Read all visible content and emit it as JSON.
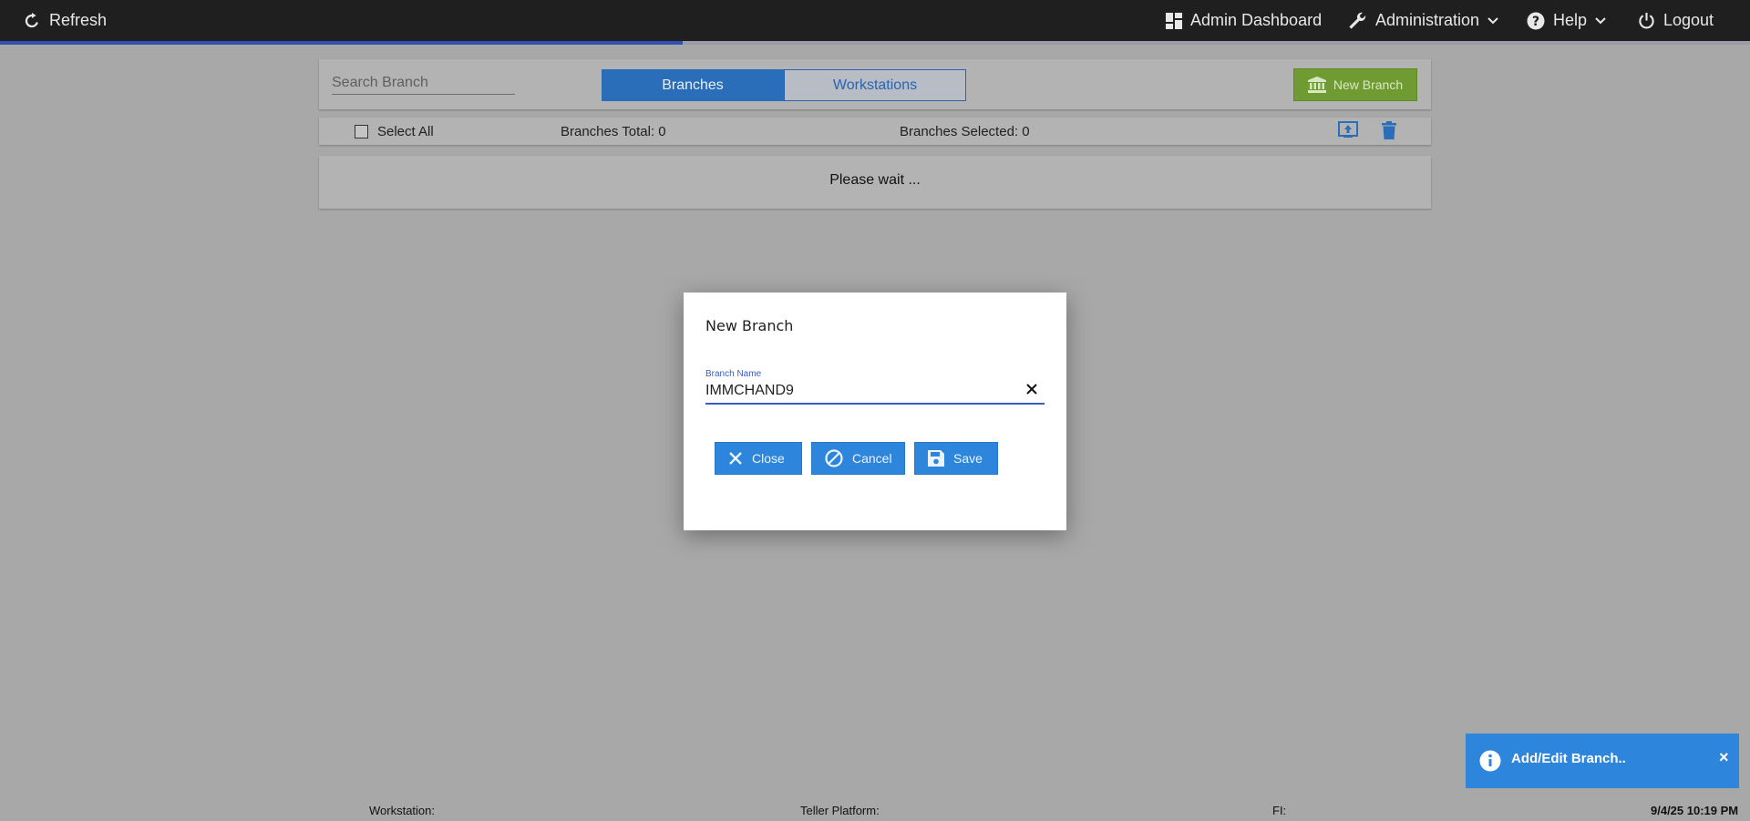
{
  "topbar": {
    "refresh_label": "Refresh",
    "admin_dashboard_label": "Admin Dashboard",
    "administration_label": "Administration",
    "help_label": "Help",
    "logout_label": "Logout"
  },
  "progress": {
    "fraction": 0.39
  },
  "toolbar": {
    "search_placeholder": "Search Branch",
    "tabs": [
      {
        "label": "Branches",
        "active": true
      },
      {
        "label": "Workstations",
        "active": false
      }
    ],
    "new_branch_label": "New Branch"
  },
  "selection": {
    "select_all_label": "Select All",
    "branches_total": "Branches Total: 0",
    "branches_selected": "Branches Selected: 0"
  },
  "list": {
    "status_message": "Please wait ..."
  },
  "modal": {
    "title": "New Branch",
    "field_label": "Branch Name",
    "field_value": "IMMCHAND9",
    "buttons": {
      "close": "Close",
      "cancel": "Cancel",
      "save": "Save"
    }
  },
  "toast": {
    "message": "Add/Edit Branch..",
    "close_glyph": "×"
  },
  "footer": {
    "workstation": "Workstation:",
    "teller_platform": "Teller Platform:",
    "fi": "FI:",
    "datetime": "9/4/25 10:19 PM"
  },
  "colors": {
    "topbar": "#1f1f1f",
    "primary_blue": "#2d86dc",
    "green": "#6f9b32",
    "overlay": "#a8a8a8"
  }
}
